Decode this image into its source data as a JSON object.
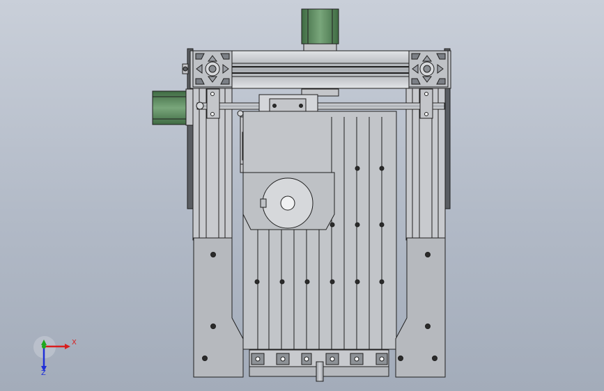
{
  "view": {
    "triad": {
      "x_label": "X",
      "z_label": "Z",
      "x_color": "#d81f1f",
      "y_color": "#1fa81f",
      "z_color": "#1f2fd8"
    }
  },
  "colors": {
    "background_top": "#c9cfd9",
    "background_bottom": "#a3acba",
    "steel": "#c4c6ca",
    "steel_dark": "#8e9297",
    "outline": "#1f1f1f",
    "motor_green": "#5e8a5e",
    "plate": "#b6b9be",
    "bore": "#2b2b2b"
  }
}
